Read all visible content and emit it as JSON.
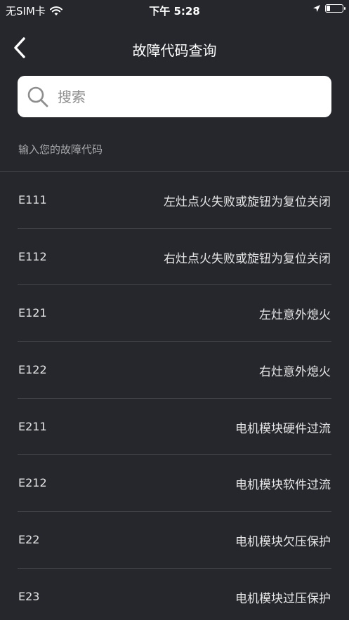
{
  "status_bar": {
    "carrier": "无SIM卡",
    "time": "下午 5:28",
    "icons": [
      "wifi-icon",
      "location-arrow-icon",
      "battery-icon"
    ]
  },
  "nav": {
    "title": "故障代码查询",
    "back_icon": "chevron-left-icon"
  },
  "search": {
    "placeholder": "搜索",
    "value": "",
    "icon": "search-icon"
  },
  "hint": "输入您的故障代码",
  "faults": [
    {
      "code": "E111",
      "description": "左灶点火失败或旋钮为复位关闭"
    },
    {
      "code": "E112",
      "description": "右灶点火失败或旋钮为复位关闭"
    },
    {
      "code": "E121",
      "description": "左灶意外熄火"
    },
    {
      "code": "E122",
      "description": "右灶意外熄火"
    },
    {
      "code": "E211",
      "description": "电机模块硬件过流"
    },
    {
      "code": "E212",
      "description": "电机模块软件过流"
    },
    {
      "code": "E22",
      "description": "电机模块欠压保护"
    },
    {
      "code": "E23",
      "description": "电机模块过压保护"
    }
  ],
  "colors": {
    "background": "#25272c",
    "divider": "#3f4147",
    "text": "#e6e6e6",
    "hint": "#a7a8ab",
    "search_bg": "#ffffff"
  }
}
